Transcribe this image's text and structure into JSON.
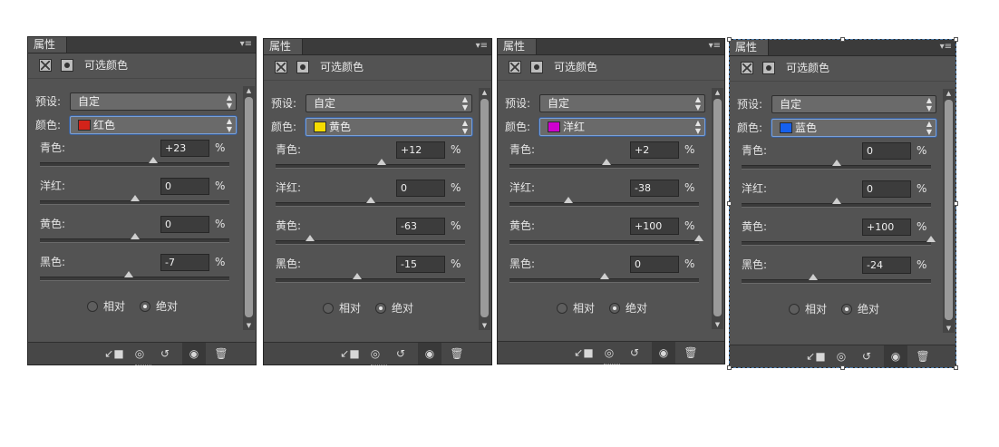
{
  "tab_label": "属性",
  "header_title": "可选颜色",
  "preset_label": "预设:",
  "preset_value": "自定",
  "color_label": "颜色:",
  "percent": "%",
  "method_relative": "相对",
  "method_absolute": "绝对",
  "sliders": [
    "青色:",
    "洋红:",
    "黄色:",
    "黑色:"
  ],
  "panels": [
    {
      "color_name": "红色",
      "swatch": "#d2231a",
      "values": [
        "+23",
        "0",
        "0",
        "-7"
      ],
      "fractions": [
        0.6,
        0.5,
        0.5,
        0.47
      ]
    },
    {
      "color_name": "黄色",
      "swatch": "#f5dc00",
      "values": [
        "+12",
        "0",
        "-63",
        "-15"
      ],
      "fractions": [
        0.56,
        0.5,
        0.18,
        0.43
      ]
    },
    {
      "color_name": "洋红",
      "swatch": "#cf00cf",
      "values": [
        "+2",
        "-38",
        "+100",
        "0"
      ],
      "fractions": [
        0.51,
        0.31,
        1.0,
        0.5
      ]
    },
    {
      "color_name": "蓝色",
      "swatch": "#1560ee",
      "values": [
        "0",
        "0",
        "+100",
        "-24"
      ],
      "fractions": [
        0.5,
        0.5,
        1.0,
        0.38
      ]
    }
  ],
  "colors": {
    "panel_bg": "#535353",
    "selection": "#4f7fb0"
  },
  "icons": {
    "adjustment": "adjustment-layer-icon",
    "mask": "layer-mask-icon",
    "clip": "clip-to-layer-icon",
    "view_previous": "view-previous-state-icon",
    "reset": "reset-icon",
    "visibility": "eye-icon",
    "delete": "trash-icon",
    "menu": "panel-menu-icon"
  }
}
